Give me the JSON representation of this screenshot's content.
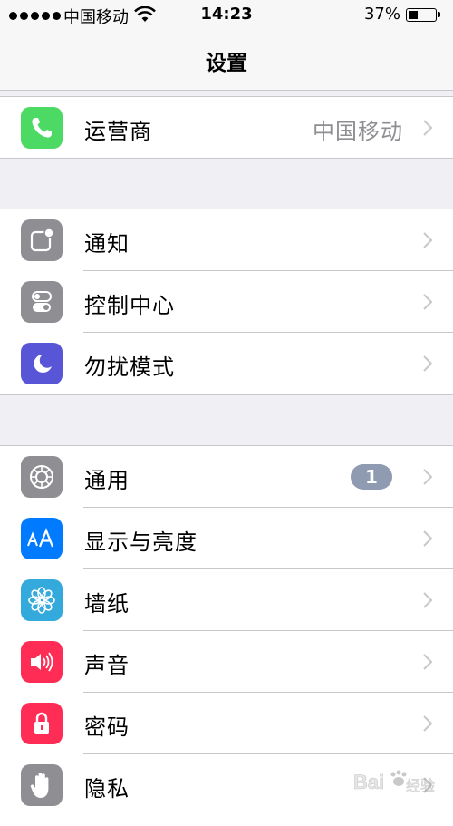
{
  "status_bar": {
    "carrier": "中国移动",
    "time": "14:23",
    "battery": "37%",
    "battery_level": 0.37
  },
  "nav": {
    "title": "设置"
  },
  "groups": [
    {
      "rows": [
        {
          "label": "运营商",
          "value": "中国移动",
          "icon": "phone-icon",
          "color": "#4cd964"
        }
      ]
    },
    {
      "rows": [
        {
          "label": "通知",
          "icon": "notifications-icon",
          "color": "#8e8e93"
        },
        {
          "label": "控制中心",
          "icon": "control-center-icon",
          "color": "#8e8e93"
        },
        {
          "label": "勿扰模式",
          "icon": "moon-icon",
          "color": "#5856d6"
        }
      ]
    },
    {
      "rows": [
        {
          "label": "通用",
          "badge": "1",
          "icon": "gear-icon",
          "color": "#8e8e93"
        },
        {
          "label": "显示与亮度",
          "icon": "display-aa-icon",
          "color": "#007aff"
        },
        {
          "label": "墙纸",
          "icon": "wallpaper-flower-icon",
          "color": "#34aadc"
        },
        {
          "label": "声音",
          "icon": "speaker-icon",
          "color": "#ff2d55"
        },
        {
          "label": "密码",
          "icon": "lock-icon",
          "color": "#ff2d55"
        },
        {
          "label": "隐私",
          "icon": "hand-icon",
          "color": "#8e8e93"
        }
      ]
    }
  ],
  "watermark": {
    "glyph": "Bai",
    "text": "经验"
  }
}
